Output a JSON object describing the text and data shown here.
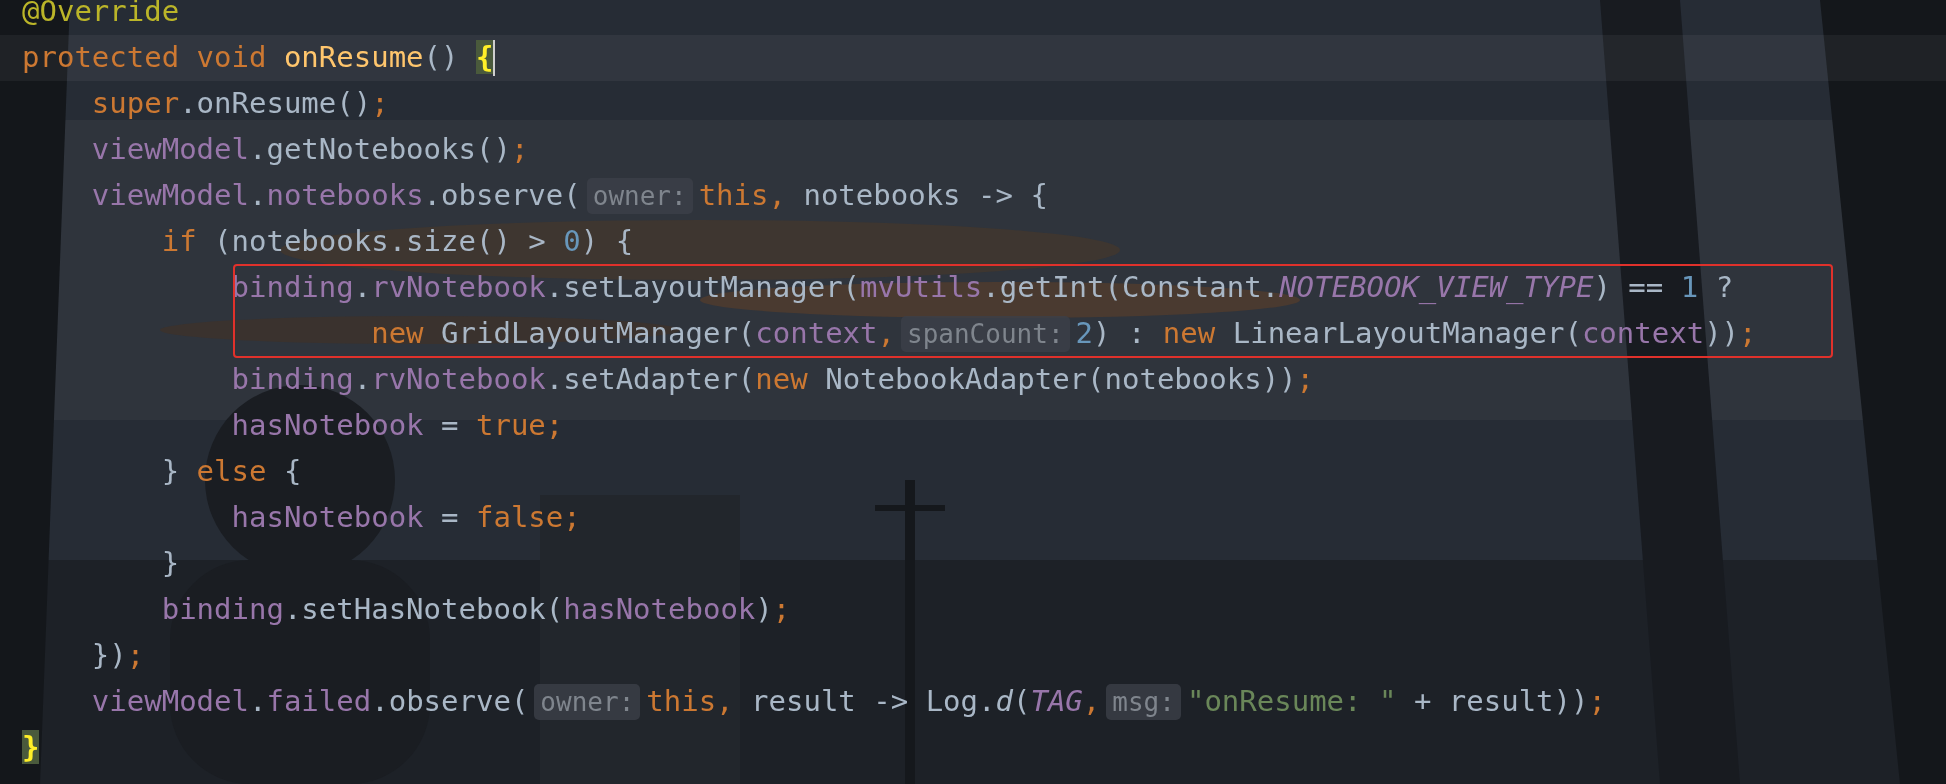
{
  "editor": {
    "lines": [
      {
        "segments": [
          {
            "kind": "code",
            "tokens": [
              {
                "kind": "annotation",
                "text": "@Override"
              }
            ]
          }
        ]
      },
      {
        "current": true,
        "caret": true,
        "segments": [
          {
            "kind": "code",
            "tokens": [
              {
                "kind": "keyword",
                "text": "protected void "
              },
              {
                "kind": "declaration",
                "text": "onResume"
              },
              {
                "kind": "plain",
                "text": "() "
              },
              {
                "kind": "plain",
                "text": "{",
                "matched": true
              }
            ]
          }
        ]
      },
      {
        "segments": [
          {
            "kind": "code",
            "tokens": [
              {
                "kind": "keyword",
                "text": "    super"
              },
              {
                "kind": "plain",
                "text": ".onResume()"
              },
              {
                "kind": "keyword",
                "text": ";"
              }
            ]
          }
        ]
      },
      {
        "segments": [
          {
            "kind": "code",
            "tokens": [
              {
                "kind": "field",
                "text": "    viewModel"
              },
              {
                "kind": "plain",
                "text": ".getNotebooks()"
              },
              {
                "kind": "keyword",
                "text": ";"
              }
            ]
          }
        ]
      },
      {
        "segments": [
          {
            "kind": "code",
            "tokens": [
              {
                "kind": "field",
                "text": "    viewModel"
              },
              {
                "kind": "plain",
                "text": "."
              },
              {
                "kind": "field",
                "text": "notebooks"
              },
              {
                "kind": "plain",
                "text": ".observe("
              }
            ]
          },
          {
            "kind": "hint",
            "text": "owner:"
          },
          {
            "kind": "code",
            "tokens": [
              {
                "kind": "keyword",
                "text": "this,"
              },
              {
                "kind": "plain",
                "text": " notebooks -> {"
              }
            ]
          }
        ]
      },
      {
        "segments": [
          {
            "kind": "code",
            "tokens": [
              {
                "kind": "keyword",
                "text": "        if"
              },
              {
                "kind": "plain",
                "text": " (notebooks.size() > "
              },
              {
                "kind": "number",
                "text": "0"
              },
              {
                "kind": "plain",
                "text": ") {"
              }
            ]
          }
        ]
      },
      {
        "boxed": true,
        "segments": [
          {
            "kind": "code",
            "tokens": [
              {
                "kind": "field",
                "text": "            binding"
              },
              {
                "kind": "plain",
                "text": "."
              },
              {
                "kind": "field",
                "text": "rvNotebook"
              },
              {
                "kind": "plain",
                "text": ".setLayoutManager("
              },
              {
                "kind": "field",
                "text": "mvUtils"
              },
              {
                "kind": "plain",
                "text": ".getInt(Constant."
              },
              {
                "kind": "static",
                "text": "NOTEBOOK_VIEW_TYPE"
              },
              {
                "kind": "plain",
                "text": ") == "
              },
              {
                "kind": "number",
                "text": "1"
              },
              {
                "kind": "plain",
                "text": " ?"
              }
            ]
          }
        ]
      },
      {
        "boxed": true,
        "segments": [
          {
            "kind": "code",
            "tokens": [
              {
                "kind": "keyword",
                "text": "                    new"
              },
              {
                "kind": "plain",
                "text": " GridLayoutManager("
              },
              {
                "kind": "field",
                "text": "context"
              },
              {
                "kind": "keyword",
                "text": ","
              }
            ]
          },
          {
            "kind": "hint",
            "text": "spanCount:"
          },
          {
            "kind": "code",
            "tokens": [
              {
                "kind": "number",
                "text": "2"
              },
              {
                "kind": "plain",
                "text": ") : "
              },
              {
                "kind": "keyword",
                "text": "new"
              },
              {
                "kind": "plain",
                "text": " LinearLayoutManager("
              },
              {
                "kind": "field",
                "text": "context"
              },
              {
                "kind": "plain",
                "text": "))"
              },
              {
                "kind": "keyword",
                "text": ";"
              }
            ]
          }
        ]
      },
      {
        "segments": [
          {
            "kind": "code",
            "tokens": [
              {
                "kind": "field",
                "text": "            binding"
              },
              {
                "kind": "plain",
                "text": "."
              },
              {
                "kind": "field",
                "text": "rvNotebook"
              },
              {
                "kind": "plain",
                "text": ".setAdapter("
              },
              {
                "kind": "keyword",
                "text": "new"
              },
              {
                "kind": "plain",
                "text": " NotebookAdapter(notebooks))"
              },
              {
                "kind": "keyword",
                "text": ";"
              }
            ]
          }
        ]
      },
      {
        "segments": [
          {
            "kind": "code",
            "tokens": [
              {
                "kind": "field",
                "text": "            hasNotebook"
              },
              {
                "kind": "plain",
                "text": " = "
              },
              {
                "kind": "keyword",
                "text": "true;"
              }
            ]
          }
        ]
      },
      {
        "segments": [
          {
            "kind": "code",
            "tokens": [
              {
                "kind": "plain",
                "text": "        } "
              },
              {
                "kind": "keyword",
                "text": "else"
              },
              {
                "kind": "plain",
                "text": " {"
              }
            ]
          }
        ]
      },
      {
        "segments": [
          {
            "kind": "code",
            "tokens": [
              {
                "kind": "field",
                "text": "            hasNotebook"
              },
              {
                "kind": "plain",
                "text": " = "
              },
              {
                "kind": "keyword",
                "text": "false;"
              }
            ]
          }
        ]
      },
      {
        "segments": [
          {
            "kind": "code",
            "tokens": [
              {
                "kind": "plain",
                "text": "        }"
              }
            ]
          }
        ]
      },
      {
        "segments": [
          {
            "kind": "code",
            "tokens": [
              {
                "kind": "field",
                "text": "        binding"
              },
              {
                "kind": "plain",
                "text": ".setHasNotebook("
              },
              {
                "kind": "field",
                "text": "hasNotebook"
              },
              {
                "kind": "plain",
                "text": ")"
              },
              {
                "kind": "keyword",
                "text": ";"
              }
            ]
          }
        ]
      },
      {
        "segments": [
          {
            "kind": "code",
            "tokens": [
              {
                "kind": "plain",
                "text": "    })"
              },
              {
                "kind": "keyword",
                "text": ";"
              }
            ]
          }
        ]
      },
      {
        "segments": [
          {
            "kind": "code",
            "tokens": [
              {
                "kind": "field",
                "text": "    viewModel"
              },
              {
                "kind": "plain",
                "text": "."
              },
              {
                "kind": "field",
                "text": "failed"
              },
              {
                "kind": "plain",
                "text": ".observe("
              }
            ]
          },
          {
            "kind": "hint",
            "text": "owner:"
          },
          {
            "kind": "code",
            "tokens": [
              {
                "kind": "keyword",
                "text": "this,"
              },
              {
                "kind": "plain",
                "text": " result -> Log."
              },
              {
                "kind": "italic",
                "text": "d"
              },
              {
                "kind": "plain",
                "text": "("
              },
              {
                "kind": "static",
                "text": "TAG"
              },
              {
                "kind": "keyword",
                "text": ","
              }
            ]
          },
          {
            "kind": "hint",
            "text": "msg:"
          },
          {
            "kind": "code",
            "tokens": [
              {
                "kind": "string",
                "text": "\"onResume: \""
              },
              {
                "kind": "plain",
                "text": " + result))"
              },
              {
                "kind": "keyword",
                "text": ";"
              }
            ]
          }
        ]
      },
      {
        "segments": [
          {
            "kind": "code",
            "tokens": [
              {
                "kind": "plain",
                "text": "}",
                "matched": true
              }
            ]
          }
        ]
      }
    ]
  }
}
